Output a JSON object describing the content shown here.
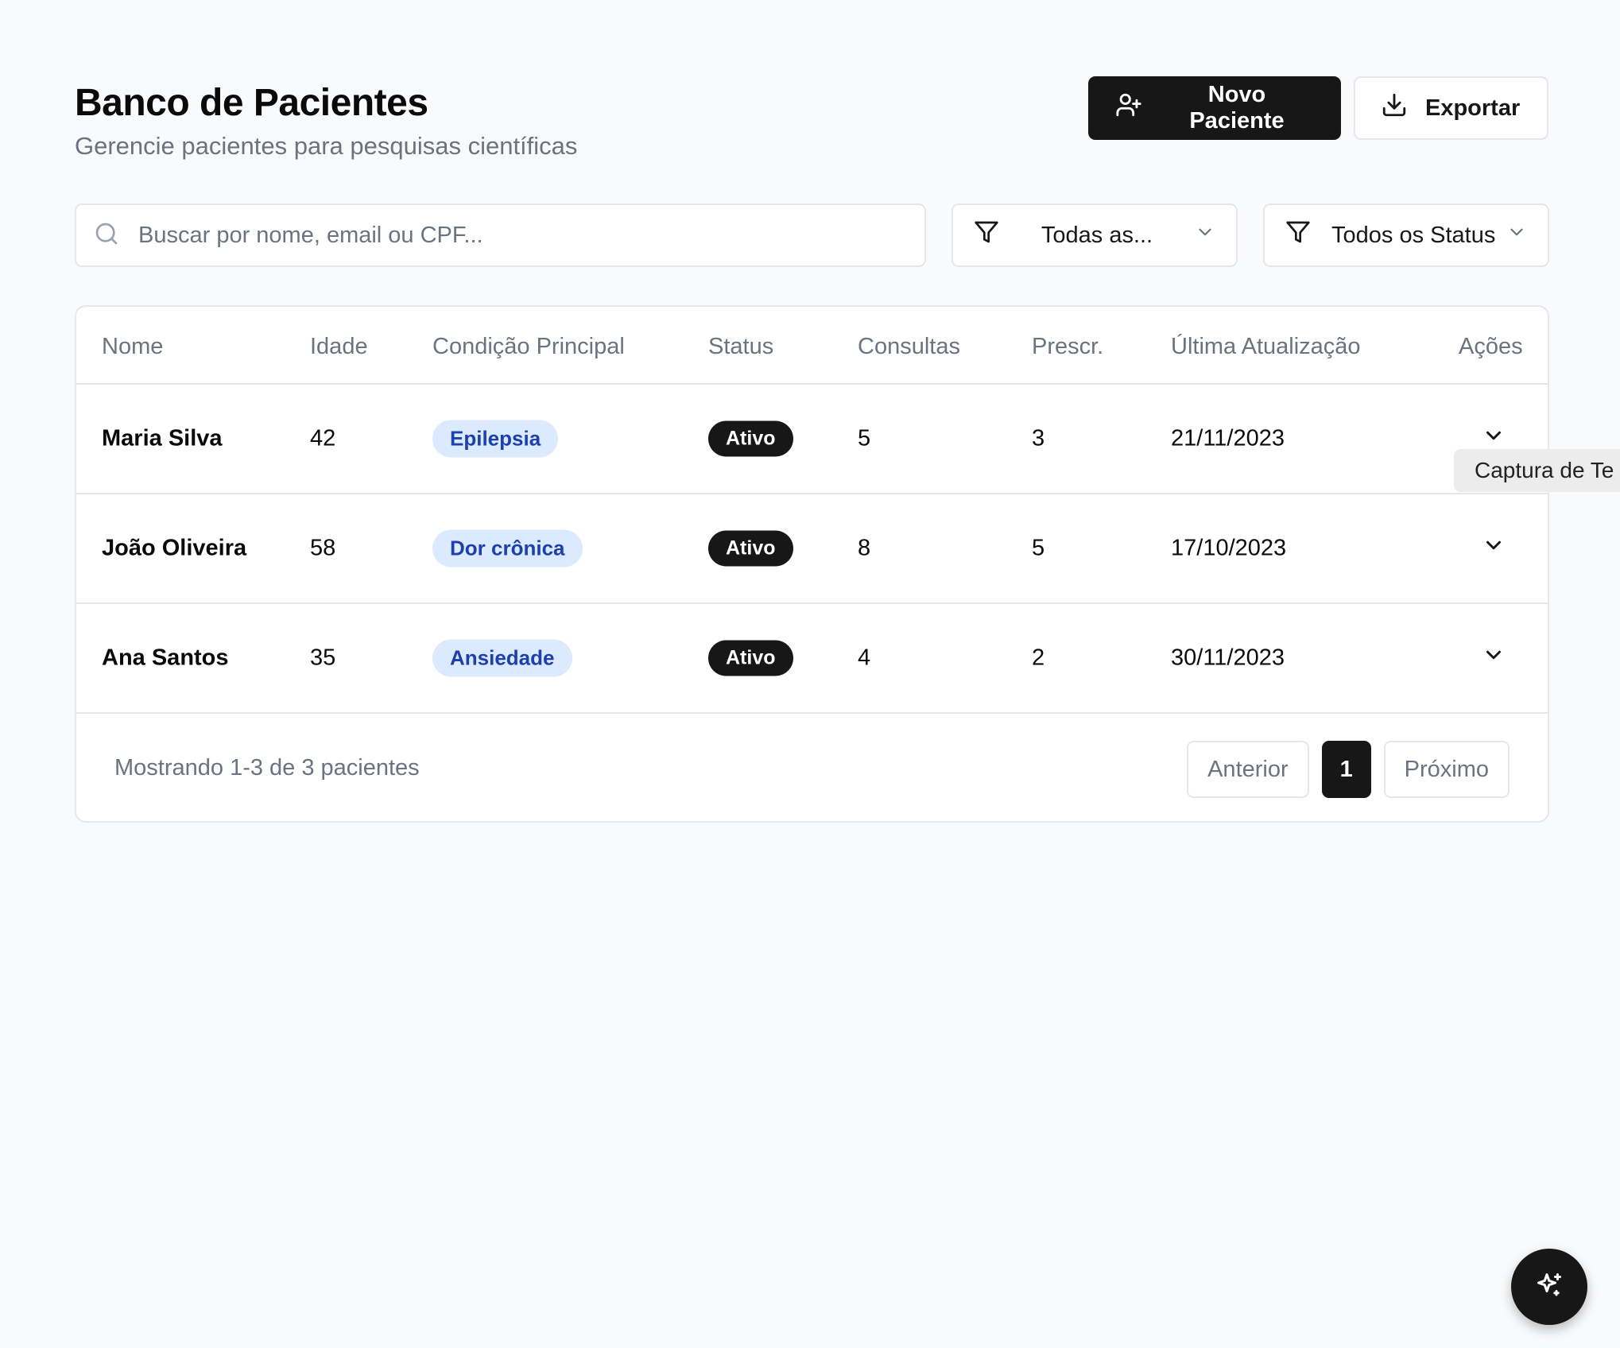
{
  "header": {
    "title": "Banco de Pacientes",
    "subtitle": "Gerencie pacientes para pesquisas científicas",
    "new_patient_label": "Novo Paciente",
    "new_patient_icon": "user-plus-icon",
    "export_label": "Exportar",
    "export_icon": "download-icon"
  },
  "toolbar": {
    "search_placeholder": "Buscar por nome, email ou CPF...",
    "search_icon": "search-icon",
    "condition_filter": "Todas as...",
    "status_filter": "Todos os Status",
    "filter_icon": "filter-icon"
  },
  "table": {
    "columns": [
      "Nome",
      "Idade",
      "Condição Principal",
      "Status",
      "Consultas",
      "Prescr.",
      "Última Atualização",
      "Ações"
    ],
    "rows": [
      {
        "name": "Maria Silva",
        "age": "42",
        "condition": "Epilepsia",
        "status": "Ativo",
        "consultas": "5",
        "prescr": "3",
        "updated": "21/11/2023"
      },
      {
        "name": "João Oliveira",
        "age": "58",
        "condition": "Dor crônica",
        "status": "Ativo",
        "consultas": "8",
        "prescr": "5",
        "updated": "17/10/2023"
      },
      {
        "name": "Ana Santos",
        "age": "35",
        "condition": "Ansiedade",
        "status": "Ativo",
        "consultas": "4",
        "prescr": "2",
        "updated": "30/11/2023"
      }
    ]
  },
  "pagination": {
    "info": "Mostrando 1-3 de 3 pacientes",
    "prev": "Anterior",
    "current": "1",
    "next": "Próximo"
  },
  "tooltip": {
    "text": "Captura de Te"
  },
  "fab": {
    "icon": "sparkles-icon"
  },
  "colors": {
    "background": "#f9fafb",
    "primary": "#171717",
    "tag_bg": "#dbeafe",
    "tag_text": "#1e40af",
    "muted_text": "#6b7280",
    "border": "#e5e7eb"
  }
}
